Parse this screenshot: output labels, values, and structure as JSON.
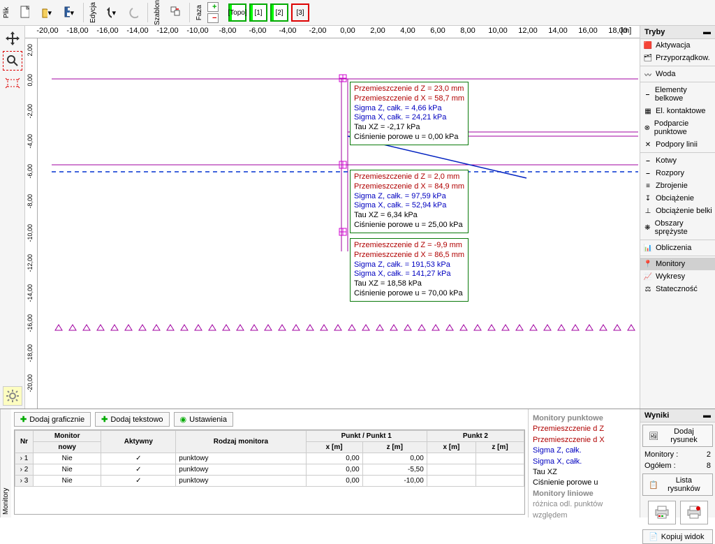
{
  "toolbar": {
    "menu_file": "Plik",
    "menu_edit": "Edycja",
    "menu_template": "Szablon",
    "menu_phase": "Faza",
    "stages": [
      "[Topo]",
      "[1]",
      "[2]",
      "[3]"
    ]
  },
  "ruler_unit": "[m]",
  "ruler_h": [
    "-20,00",
    "-18,00",
    "-16,00",
    "-14,00",
    "-12,00",
    "-10,00",
    "-8,00",
    "-6,00",
    "-4,00",
    "-2,00",
    "0,00",
    "2,00",
    "4,00",
    "6,00",
    "8,00",
    "10,00",
    "12,00",
    "14,00",
    "16,00",
    "18,00"
  ],
  "ruler_v": [
    "2,00",
    "0,00",
    "-2,00",
    "-4,00",
    "-6,00",
    "-8,00",
    "-10,00",
    "-12,00",
    "-14,00",
    "-16,00",
    "-18,00",
    "-20,00"
  ],
  "modes": {
    "title": "Tryby",
    "items": [
      "Aktywacja",
      "Przyporządkow.",
      "Woda",
      "Elementy belkowe",
      "El. kontaktowe",
      "Podparcie punktowe",
      "Podpory linii",
      "Kotwy",
      "Rozpory",
      "Zbrojenie",
      "Obciążenie",
      "Obciążenie belki",
      "Obszary sprężyste",
      "Obliczenia",
      "Monitory",
      "Wykresy",
      "Stateczność"
    ],
    "selected": "Monitory"
  },
  "boxes": [
    {
      "dz": "Przemieszczenie d Z = 23,0 mm",
      "dx": "Przemieszczenie d X = 58,7 mm",
      "sz": "Sigma Z, całk. = 4,66 kPa",
      "sx": "Sigma X, całk. = 24,21 kPa",
      "tau": "Tau XZ = -2,17 kPa",
      "p": "Ciśnienie porowe u = 0,00 kPa"
    },
    {
      "dz": "Przemieszczenie d Z = 2,0 mm",
      "dx": "Przemieszczenie d X = 84,9 mm",
      "sz": "Sigma Z, całk. = 97,59 kPa",
      "sx": "Sigma X, całk. = 52,94 kPa",
      "tau": "Tau XZ = 6,34 kPa",
      "p": "Ciśnienie porowe u = 25,00 kPa"
    },
    {
      "dz": "Przemieszczenie d Z = -9,9 mm",
      "dx": "Przemieszczenie d X = 86,5 mm",
      "sz": "Sigma Z, całk. = 191,53 kPa",
      "sx": "Sigma X, całk. = 141,27 kPa",
      "tau": "Tau XZ = 18,58 kPa",
      "p": "Ciśnienie porowe u = 70,00 kPa"
    }
  ],
  "buttons": {
    "add_graphic": "Dodaj graficznie",
    "add_text": "Dodaj tekstowo",
    "settings": "Ustawienia"
  },
  "table": {
    "vtab": "Monitory",
    "h_nr": "Nr",
    "h_monitor": "Monitor",
    "h_nowy": "nowy",
    "h_aktywny": "Aktywny",
    "h_rodzaj": "Rodzaj monitora",
    "h_p1": "Punkt / Punkt 1",
    "h_p2": "Punkt 2",
    "h_x": "x [m]",
    "h_z": "z [m]",
    "rows": [
      {
        "nr": "1",
        "nowy": "Nie",
        "akt": "✓",
        "rodzaj": "punktowy",
        "x1": "0,00",
        "z1": "0,00",
        "x2": "",
        "z2": ""
      },
      {
        "nr": "2",
        "nowy": "Nie",
        "akt": "✓",
        "rodzaj": "punktowy",
        "x1": "0,00",
        "z1": "-5,50",
        "x2": "",
        "z2": ""
      },
      {
        "nr": "3",
        "nowy": "Nie",
        "akt": "✓",
        "rodzaj": "punktowy",
        "x1": "0,00",
        "z1": "-10,00",
        "x2": "",
        "z2": ""
      }
    ]
  },
  "legend": {
    "title": "Monitory punktowe",
    "l1": "Przemieszczenie d Z",
    "l2": "Przemieszczenie d X",
    "l3": "Sigma Z, całk.",
    "l4": "Sigma X, całk.",
    "l5": "Tau XZ",
    "l6": "Ciśnienie porowe u",
    "l7": "Monitory liniowe",
    "l8": "różnica odl. punktów względem"
  },
  "results": {
    "title": "Wyniki",
    "add_drawing": "Dodaj rysunek",
    "monitors_label": "Monitory :",
    "monitors_val": "2",
    "total_label": "Ogółem :",
    "total_val": "8",
    "list": "Lista rysunków",
    "copy_view": "Kopiuj widok"
  }
}
